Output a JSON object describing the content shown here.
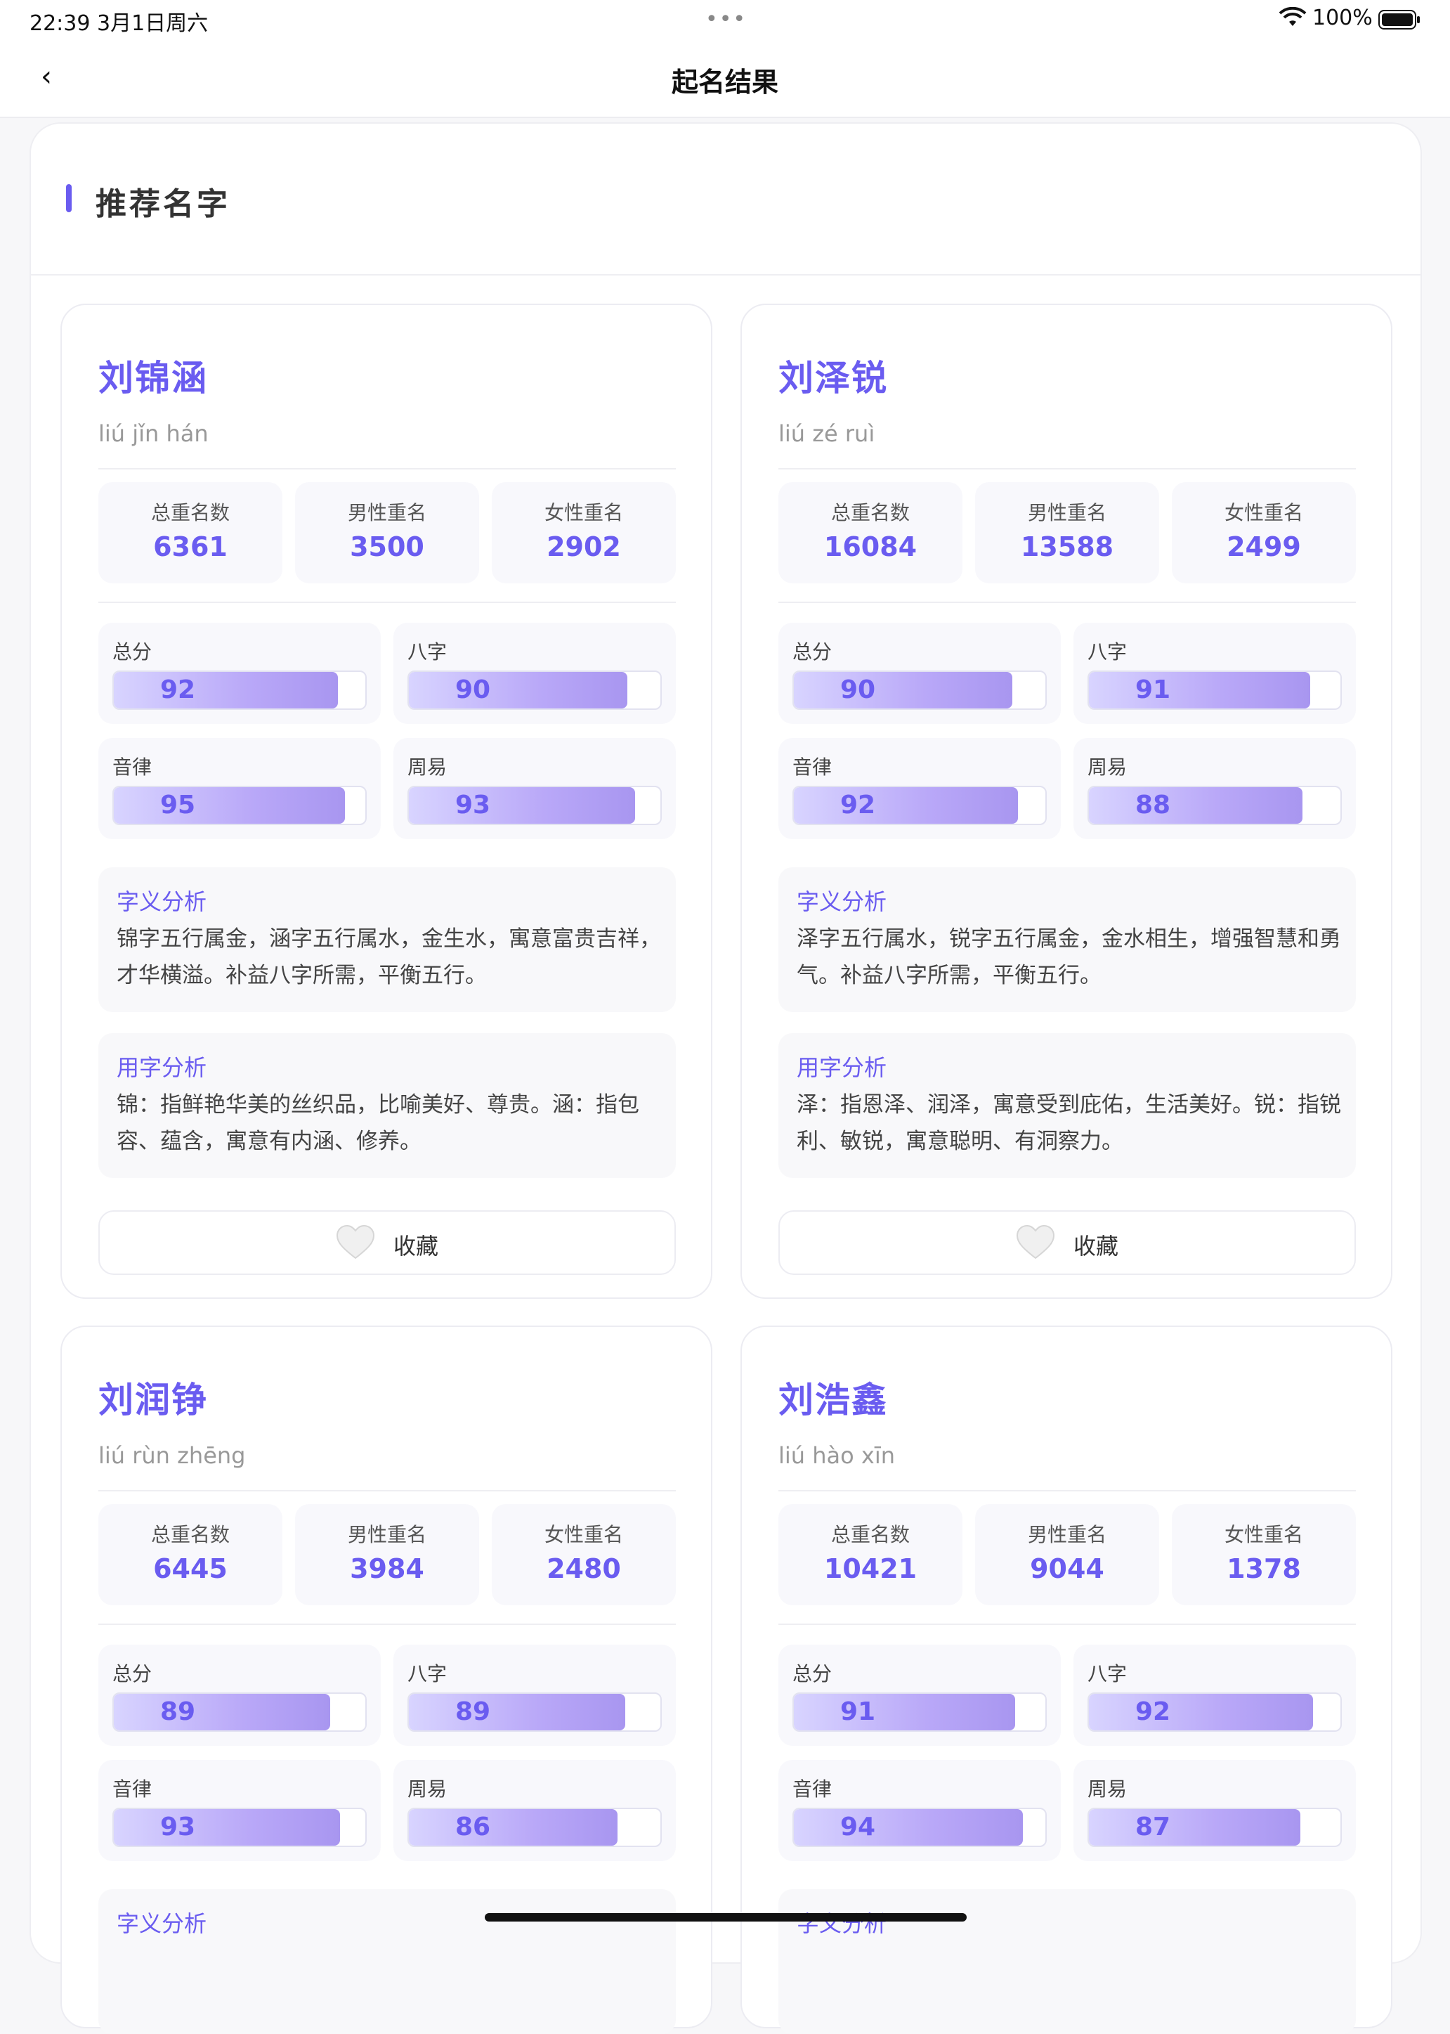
{
  "status_bar": {
    "time": "22:39   3月1日周六",
    "dots": "•••",
    "battery_text": "100%"
  },
  "nav": {
    "back": "‹",
    "title": "起名结果"
  },
  "section": {
    "title": "推荐名字"
  },
  "labels": {
    "total_dup": "总重名数",
    "male_dup": "男性重名",
    "female_dup": "女性重名",
    "total_score": "总分",
    "bazi": "八字",
    "yinlv": "音律",
    "zhouyi": "周易",
    "meaning_title": "字义分析",
    "usage_title": "用字分析",
    "favorite": "收藏"
  },
  "colors": {
    "accent": "#6a5cf0",
    "bar_start": "#d8d4ff",
    "bar_end": "#a896f0"
  },
  "names": [
    {
      "name": "刘锦涵",
      "pinyin": "liú jǐn hán",
      "total_dup": "6361",
      "male_dup": "3500",
      "female_dup": "2902",
      "scores": {
        "total": 92,
        "bazi": 90,
        "yinlv": 95,
        "zhouyi": 93
      },
      "meaning": "锦字五行属金，涵字五行属水，金生水，寓意富贵吉祥，才华横溢。补益八字所需，平衡五行。",
      "usage": "锦：指鲜艳华美的丝织品，比喻美好、尊贵。涵：指包容、蕴含，寓意有内涵、修养。"
    },
    {
      "name": "刘泽锐",
      "pinyin": "liú zé ruì",
      "total_dup": "16084",
      "male_dup": "13588",
      "female_dup": "2499",
      "scores": {
        "total": 90,
        "bazi": 91,
        "yinlv": 92,
        "zhouyi": 88
      },
      "meaning": "泽字五行属水，锐字五行属金，金水相生，增强智慧和勇气。补益八字所需，平衡五行。",
      "usage": "泽：指恩泽、润泽，寓意受到庇佑，生活美好。锐：指锐利、敏锐，寓意聪明、有洞察力。"
    },
    {
      "name": "刘润铮",
      "pinyin": "liú rùn zhēng",
      "total_dup": "6445",
      "male_dup": "3984",
      "female_dup": "2480",
      "scores": {
        "total": 89,
        "bazi": 89,
        "yinlv": 93,
        "zhouyi": 86
      },
      "meaning": "",
      "usage": ""
    },
    {
      "name": "刘浩鑫",
      "pinyin": "liú hào xīn",
      "total_dup": "10421",
      "male_dup": "9044",
      "female_dup": "1378",
      "scores": {
        "total": 91,
        "bazi": 92,
        "yinlv": 94,
        "zhouyi": 87
      },
      "meaning": "",
      "usage": ""
    }
  ]
}
